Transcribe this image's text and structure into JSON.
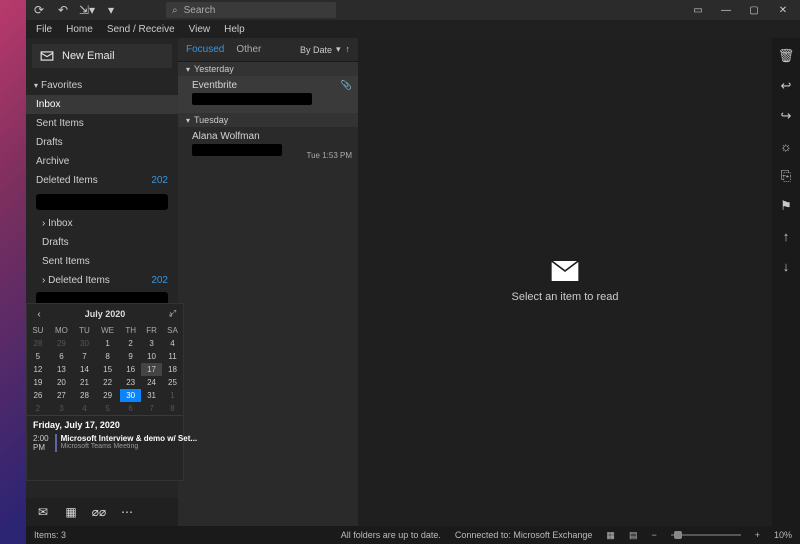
{
  "titlebar": {
    "search_placeholder": "Search"
  },
  "menu": {
    "file": "File",
    "home": "Home",
    "sendreceive": "Send / Receive",
    "view": "View",
    "help": "Help"
  },
  "sidebar": {
    "newemail": "New Email",
    "favorites_label": "Favorites",
    "fav": [
      {
        "label": "Inbox",
        "badge": ""
      },
      {
        "label": "Sent Items",
        "badge": ""
      },
      {
        "label": "Drafts",
        "badge": ""
      },
      {
        "label": "Archive",
        "badge": ""
      },
      {
        "label": "Deleted Items",
        "badge": "202"
      }
    ],
    "acct": [
      {
        "label": "Inbox",
        "badge": ""
      },
      {
        "label": "Drafts",
        "badge": ""
      },
      {
        "label": "Sent Items",
        "badge": ""
      },
      {
        "label": "Deleted Items",
        "badge": "202"
      }
    ]
  },
  "list": {
    "tab_focused": "Focused",
    "tab_other": "Other",
    "bydate": "By Date",
    "groups": [
      {
        "label": "Yesterday",
        "items": [
          {
            "sender": "Eventbrite",
            "time": "",
            "att": true
          }
        ]
      },
      {
        "label": "Tuesday",
        "items": [
          {
            "sender": "Alana Wolfman",
            "time": "Tue 1:53 PM",
            "att": false
          }
        ]
      }
    ]
  },
  "reading": {
    "empty": "Select an item to read"
  },
  "statusbar": {
    "items": "Items: 3",
    "sync": "All folders are up to date.",
    "conn": "Connected to: Microsoft Exchange",
    "zoom": "10%"
  },
  "calendar": {
    "title": "July 2020",
    "dow": [
      "SU",
      "MO",
      "TU",
      "WE",
      "TH",
      "FR",
      "SA"
    ],
    "cells": [
      [
        "28",
        "29",
        "30",
        "1",
        "2",
        "3",
        "4"
      ],
      [
        "5",
        "6",
        "7",
        "8",
        "9",
        "10",
        "11"
      ],
      [
        "12",
        "13",
        "14",
        "15",
        "16",
        "17",
        "18"
      ],
      [
        "19",
        "20",
        "21",
        "22",
        "23",
        "24",
        "25"
      ],
      [
        "26",
        "27",
        "28",
        "29",
        "30",
        "31",
        "1"
      ],
      [
        "2",
        "3",
        "4",
        "5",
        "6",
        "7",
        "8"
      ]
    ],
    "dimrows": [
      [
        0,
        0
      ],
      [
        0,
        1
      ],
      [
        0,
        2
      ],
      [
        4,
        6
      ],
      [
        5,
        0
      ],
      [
        5,
        1
      ],
      [
        5,
        2
      ],
      [
        5,
        3
      ],
      [
        5,
        4
      ],
      [
        5,
        5
      ],
      [
        5,
        6
      ]
    ],
    "hi": [
      2,
      5
    ],
    "today": [
      4,
      4
    ],
    "appt_date": "Friday, July 17, 2020",
    "appt_time": "2:00 PM",
    "appt_title": "Microsoft Interview & demo w/ Set...",
    "appt_sub": "Microsoft Teams Meeting"
  }
}
